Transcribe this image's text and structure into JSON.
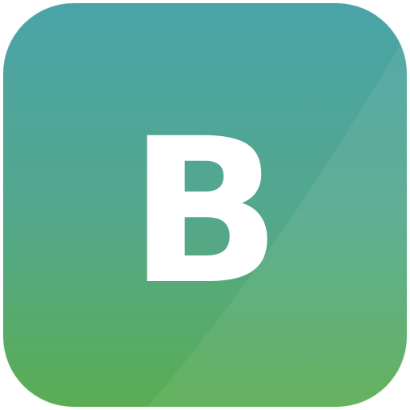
{
  "app_icon": {
    "glyph": "B",
    "colors": {
      "gradient_top": "#4aa3a8",
      "gradient_mid": "#54a88a",
      "gradient_bottom": "#5aad52",
      "glyph": "#ffffff"
    }
  }
}
